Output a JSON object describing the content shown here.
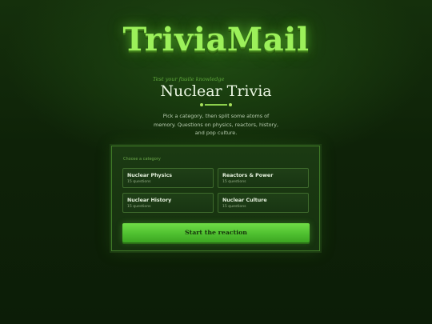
{
  "app": {
    "logo": "TriviaMail"
  },
  "hero": {
    "tagline": "Test your fissile knowledge",
    "title": "Nuclear Trivia",
    "description": "Pick a category, then split some atoms of memory. Questions on physics, reactors, history, and pop culture."
  },
  "panel": {
    "label": "Choose a category",
    "categories": [
      {
        "name": "Nuclear Physics",
        "count": "15 questions"
      },
      {
        "name": "Reactors & Power",
        "count": "15 questions"
      },
      {
        "name": "Nuclear History",
        "count": "15 questions"
      },
      {
        "name": "Nuclear Culture",
        "count": "15 questions"
      }
    ],
    "start_label": "Start the reaction"
  },
  "colors": {
    "accent": "#6fdc46",
    "logo": "#9cf05a",
    "background": "#0e2208"
  }
}
